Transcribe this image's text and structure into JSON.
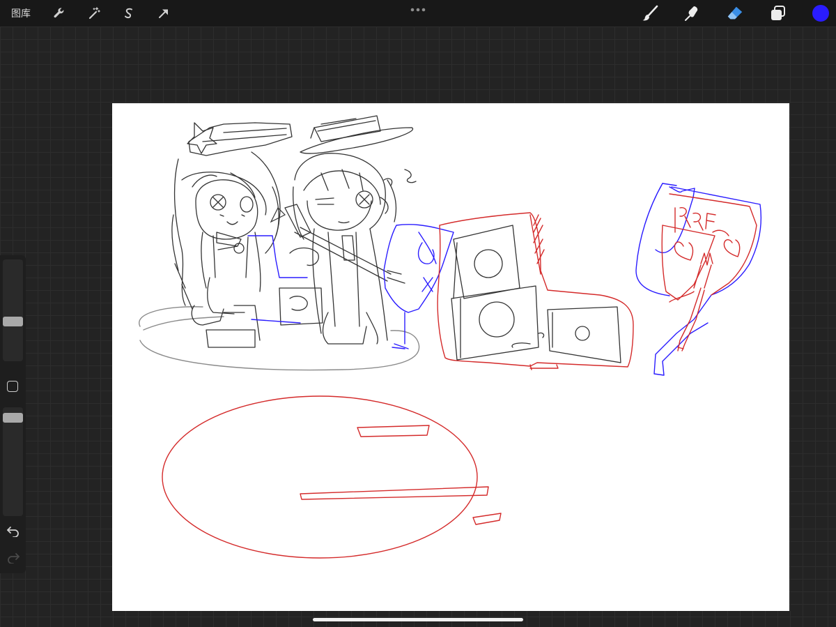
{
  "topbar": {
    "gallery_label": "图库",
    "left_tools": [
      "wrench-icon",
      "magic-wand-icon",
      "selection-icon",
      "transform-arrow-icon"
    ],
    "right_tools": [
      "brush-icon",
      "smudge-icon",
      "eraser-icon",
      "layers-icon"
    ],
    "current_color": "#2a1cff",
    "eraser_accent": "#3a8ee6"
  },
  "sidebar": {
    "brush_size": 0.72,
    "opacity": 0.92
  },
  "canvas": {
    "background": "#ffffff",
    "sketch_colors": [
      "#333333",
      "#2a1cff",
      "#d42a2a",
      "#8a8a8a"
    ],
    "sign_text": "QRFR"
  }
}
